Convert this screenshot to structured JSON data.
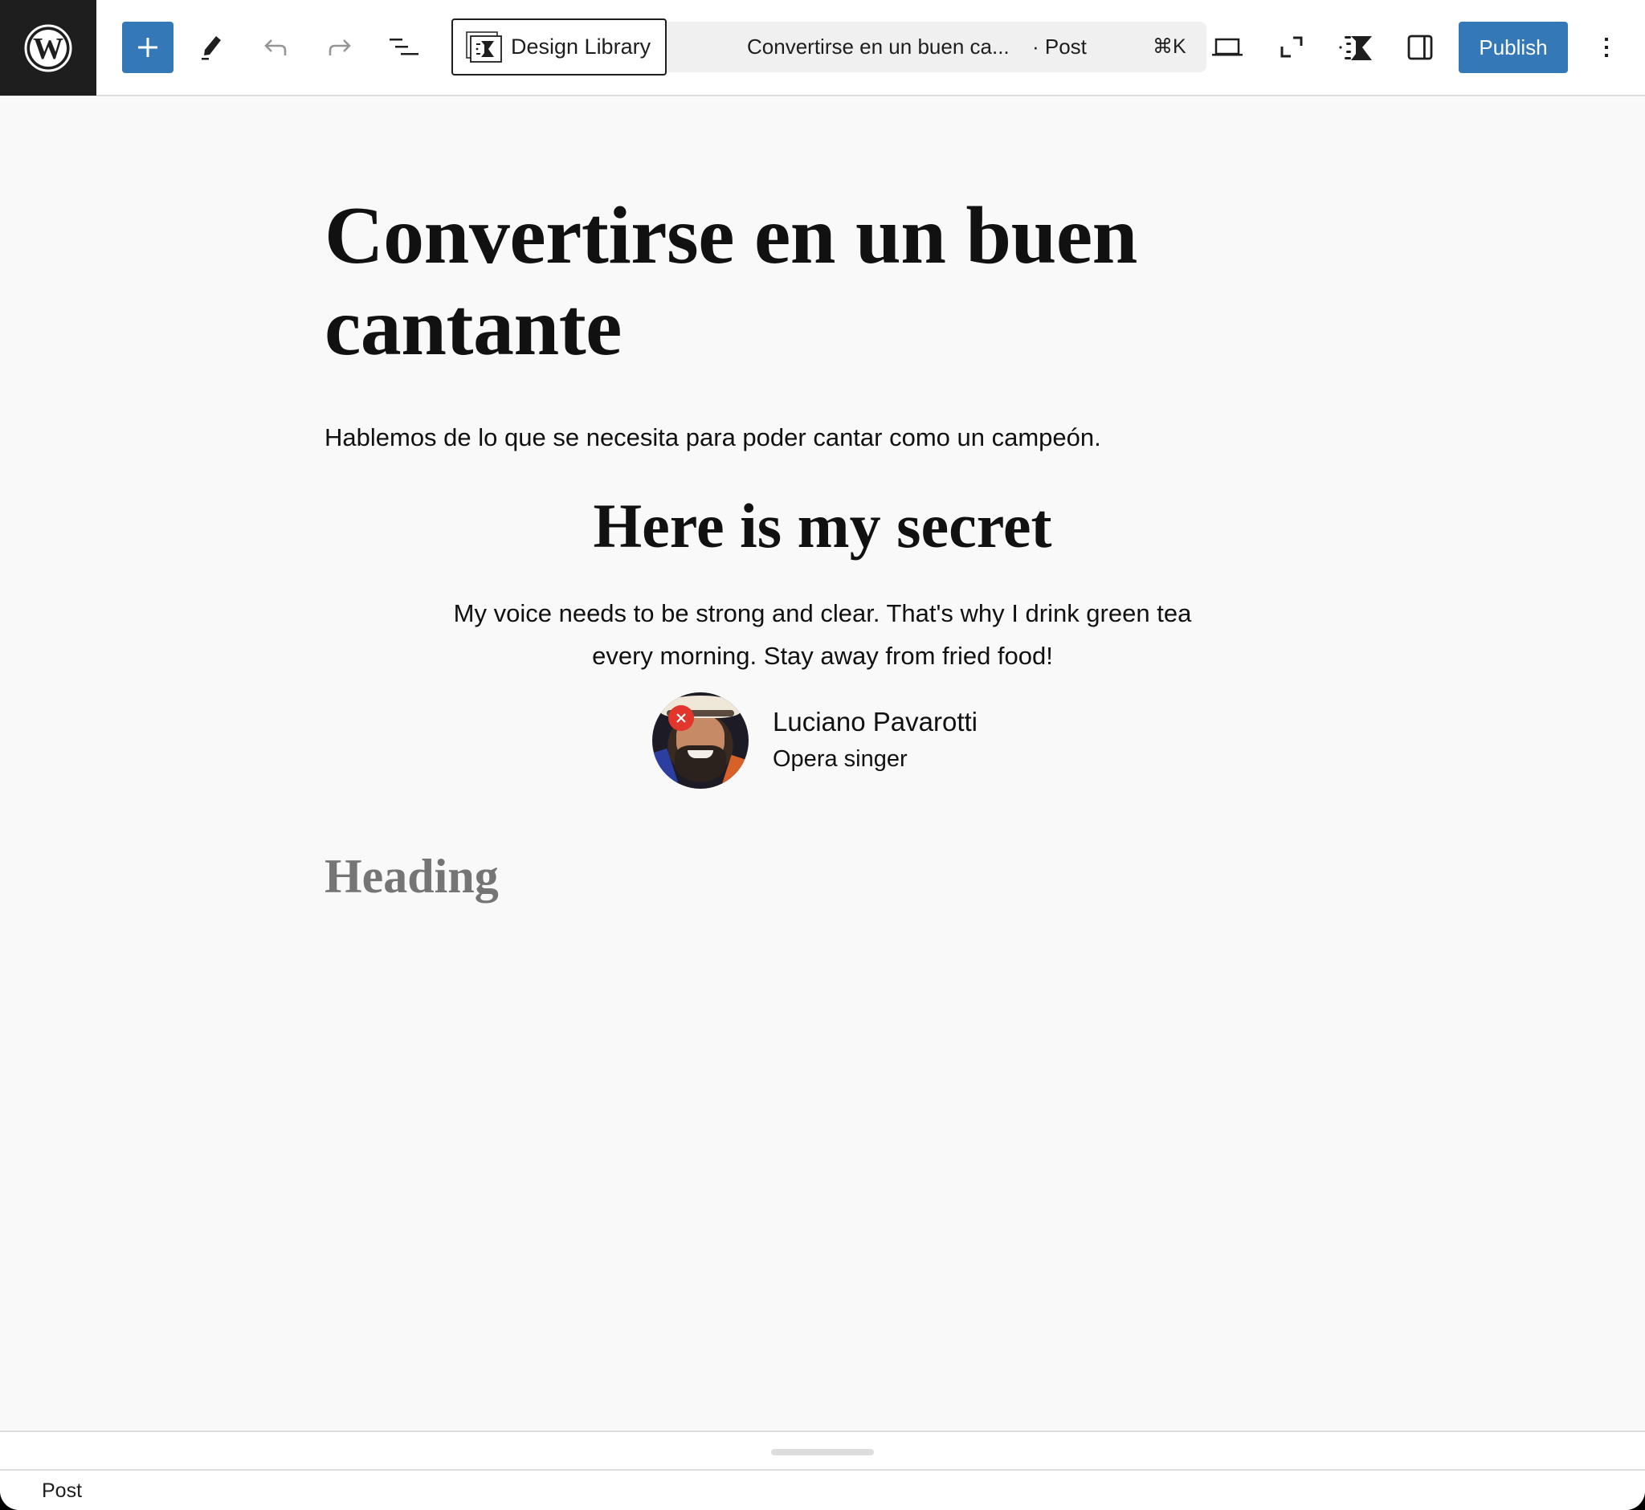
{
  "toolbar": {
    "logo": "wordpress-logo",
    "inserter_label": "Add block",
    "tools_label": "Tools",
    "undo_label": "Undo",
    "redo_label": "Redo",
    "list_view_label": "Document Overview",
    "design_library_label": "Design Library",
    "command_bar": {
      "title": "Convertirse en un buen ca...",
      "type": "· Post",
      "shortcut": "⌘K"
    },
    "preview_label": "View",
    "fullscreen_label": "Fullscreen",
    "kadence_label": "Kadence Blocks",
    "settings_label": "Settings",
    "publish_label": "Publish",
    "options_label": "Options",
    "accent_color": "#3478b8"
  },
  "content": {
    "title": "Convertirse en un buen cantante",
    "excerpt": "Hablemos de lo que se necesita para poder cantar como un campeón.",
    "secret_heading": "Here is my secret",
    "quote": "My voice needs to be strong and clear. That's why I drink green tea every morning. Stay away from fried food!",
    "author": {
      "name": "Luciano Pavarotti",
      "role": "Opera singer",
      "remove_badge_color": "#e2352b"
    },
    "heading_placeholder": "Heading"
  },
  "footer": {
    "breadcrumb": "Post"
  }
}
